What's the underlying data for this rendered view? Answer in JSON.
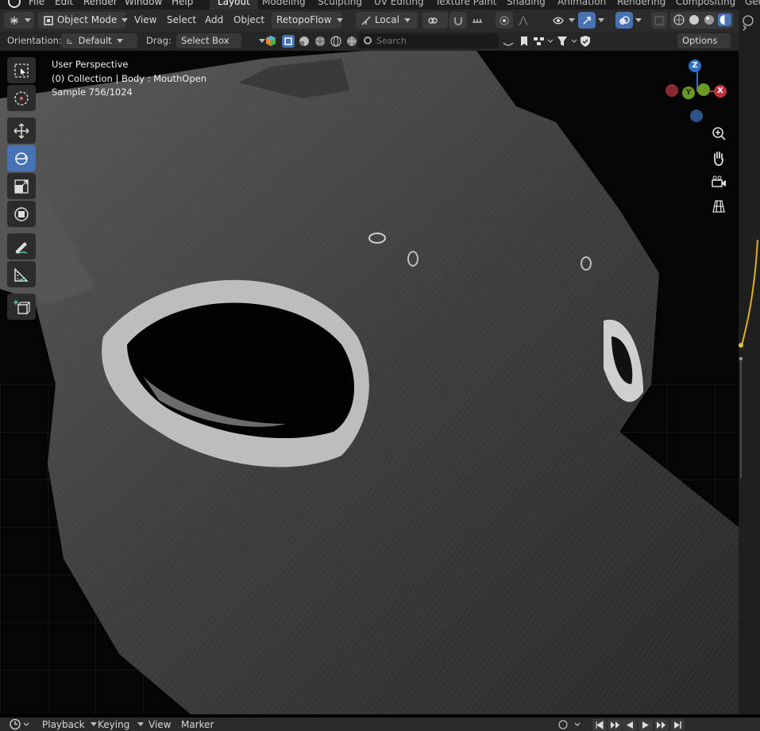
{
  "top_menu": {
    "items": [
      "File",
      "Edit",
      "Render",
      "Window",
      "Help"
    ],
    "workspaces": [
      "Layout",
      "Modeling",
      "Sculpting",
      "UV Editing",
      "Texture Paint",
      "Shading",
      "Animation",
      "Rendering",
      "Compositing",
      "Geo"
    ],
    "active_workspace": "Layout"
  },
  "header": {
    "mode": "Object Mode",
    "menus": [
      "View",
      "Select",
      "Add",
      "Object"
    ],
    "addon": "RetopoFlow",
    "transform_orientation": "Local"
  },
  "tool_settings": {
    "orientation_label": "Orientation:",
    "orientation_value": "Default",
    "drag_label": "Drag:",
    "drag_value": "Select Box",
    "search_placeholder": "Search",
    "options_label": "Options"
  },
  "viewport": {
    "perspective": "User Perspective",
    "collection_info": "(0) Collection | Body : MouthOpen",
    "sample": "Sample 756/1024"
  },
  "gizmo": {
    "x_label": "X",
    "y_label": "Y",
    "z_label": "Z",
    "x_color": "#c0323b",
    "y_color": "#6a9a24",
    "z_color": "#2f6fc0"
  },
  "timeline": {
    "menus": [
      "Playback",
      "Keying",
      "View",
      "Marker"
    ]
  },
  "colors": {
    "accent": "#4772b3",
    "header_bg": "#2b2b2b"
  }
}
